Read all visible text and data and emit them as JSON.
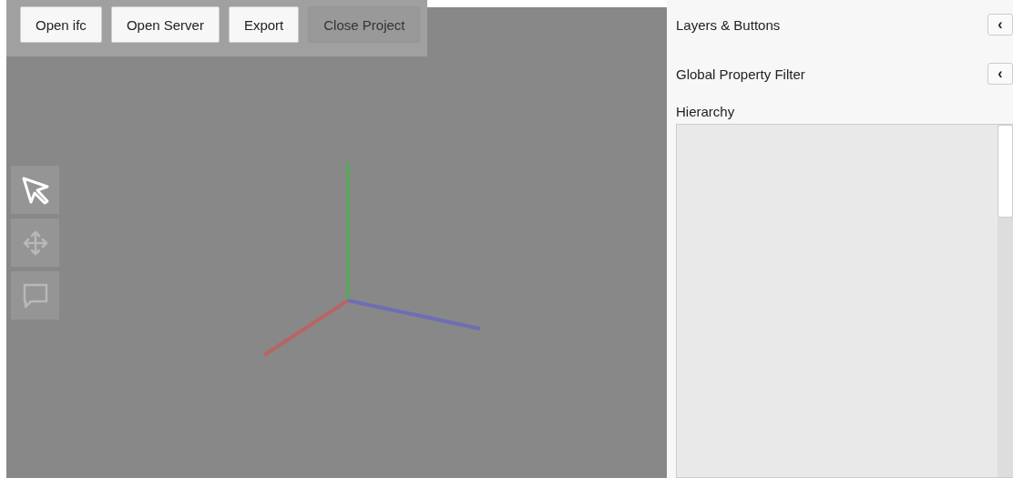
{
  "toolbar": {
    "buttons": [
      {
        "label": "Open ifc",
        "disabled": false
      },
      {
        "label": "Open Server",
        "disabled": false
      },
      {
        "label": "Export",
        "disabled": false
      },
      {
        "label": "Close Project",
        "disabled": true
      }
    ]
  },
  "tools": [
    {
      "kind": "select",
      "selected": true
    },
    {
      "kind": "move",
      "selected": false
    },
    {
      "kind": "comment",
      "selected": false
    }
  ],
  "panel": {
    "sections": [
      {
        "title": "Layers & Buttons",
        "toggle": "‹"
      },
      {
        "title": "Global Property Filter",
        "toggle": "‹"
      }
    ],
    "hierarchy": {
      "title": "Hierarchy"
    }
  }
}
